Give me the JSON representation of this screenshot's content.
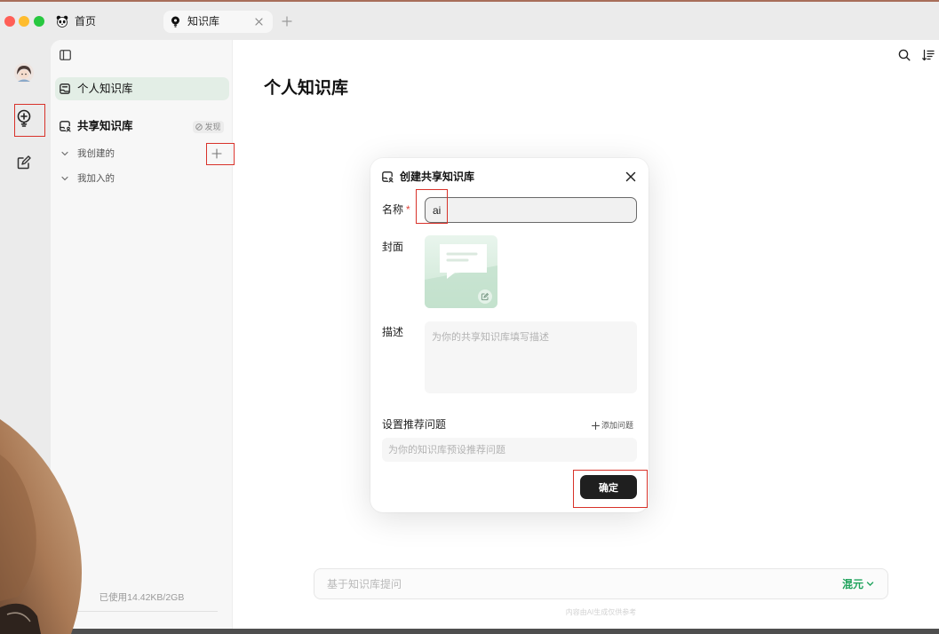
{
  "window": {
    "tabs": [
      {
        "label": "首页",
        "icon": "panda-icon",
        "active": false
      },
      {
        "label": "知识库",
        "icon": "lightbulb-icon",
        "active": true
      }
    ]
  },
  "rail": {
    "items": [
      {
        "icon": "avatar"
      },
      {
        "icon": "knowledge-bulb-icon",
        "active": true
      },
      {
        "icon": "edit-icon"
      }
    ]
  },
  "sidebar": {
    "personal_label": "个人知识库",
    "shared_label": "共享知识库",
    "discover_label": "发现",
    "groups": [
      {
        "label": "我创建的"
      },
      {
        "label": "我加入的"
      }
    ],
    "usage": "已使用14.42KB/2GB"
  },
  "main": {
    "title": "个人知识库"
  },
  "dialog": {
    "title": "创建共享知识库",
    "name_label": "名称",
    "required_mark": "*",
    "name_value": "ai",
    "cover_label": "封面",
    "desc_label": "描述",
    "desc_placeholder": "为你的共享知识库填写描述",
    "questions_label": "设置推荐问题",
    "add_question_label": "添加问题",
    "question_placeholder": "为你的知识库预设推荐问题",
    "confirm_label": "确定"
  },
  "chat": {
    "placeholder": "基于知识库提问",
    "model": "混元",
    "disclaimer": "内容由AI生成仅供参考"
  },
  "colors": {
    "accent": "#1fa35c",
    "dark": "#1f1f1f",
    "select": "#e3eee6",
    "required": "#e0443a",
    "highlight": "#d8322a"
  }
}
